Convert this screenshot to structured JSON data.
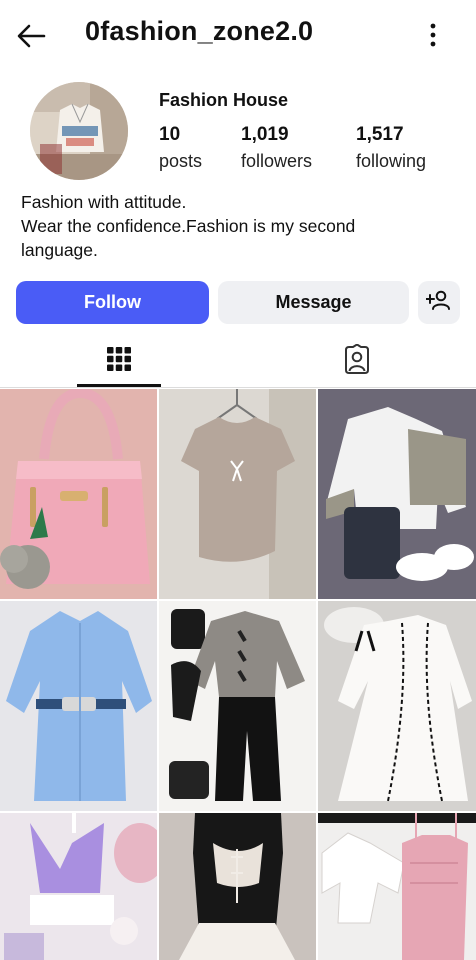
{
  "header": {
    "username": "0fashion_zone2.0",
    "back_icon": "arrow-left-icon",
    "menu_icon": "more-vertical-icon"
  },
  "profile": {
    "display_name": "Fashion House",
    "stats": {
      "posts": {
        "value": "10",
        "label": "posts"
      },
      "followers": {
        "value": "1,019",
        "label": "followers"
      },
      "following": {
        "value": "1,517",
        "label": "following"
      }
    },
    "bio": [
      "Fashion with attitude.",
      "Wear the confidence.Fashion is my second",
      "language."
    ]
  },
  "actions": {
    "follow_label": "Follow",
    "message_label": "Message",
    "suggest_icon": "add-person-icon"
  },
  "tabs": {
    "grid_icon": "grid-icon",
    "tagged_icon": "tagged-icon",
    "active": "grid"
  },
  "posts": [
    {
      "subject": "pink handbag with leaf charm"
    },
    {
      "subject": "taupe t-shirt with bow"
    },
    {
      "subject": "white and grey shirt outfit with jeans and sneakers"
    },
    {
      "subject": "blue belted shirt dress"
    },
    {
      "subject": "black and grey bow outfit with boots"
    },
    {
      "subject": "white cardigan set with black bows"
    },
    {
      "subject": "lilac halter top outfit"
    },
    {
      "subject": "black corset dress with white skirt"
    },
    {
      "subject": "white crop shirt and pink dress"
    }
  ],
  "colors": {
    "follow_button": "#4a5cf6",
    "secondary_button": "#eff0f3"
  }
}
